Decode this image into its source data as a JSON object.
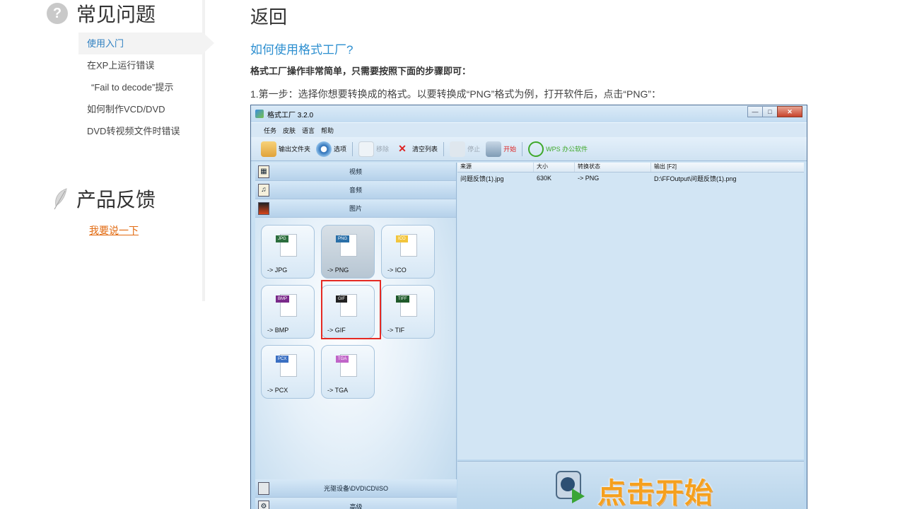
{
  "sidebar": {
    "faq_icon": "question-circle-icon",
    "faq_title": "常见问题",
    "items": [
      {
        "label": "使用入门"
      },
      {
        "label": "在XP上运行错误"
      },
      {
        "label": "“Fail to decode”提示"
      },
      {
        "label": "如何制作VCD/DVD"
      },
      {
        "label": "DVD转视频文件时错误"
      }
    ],
    "feedback_icon": "leaf-icon",
    "feedback_title": "产品反馈",
    "feedback_link": "我要说一下"
  },
  "main": {
    "back_title": "返回",
    "question_title": "如何使用格式工厂?",
    "intro": "格式工厂操作非常简单，只需要按照下面的步骤即可：",
    "step1": "1.第一步：选择你想要转换成的格式。以要转换成“PNG”格式为例，打开软件后，点击“PNG”："
  },
  "app": {
    "title": "格式工厂 3.2.0",
    "window_buttons": [
      "—",
      "□",
      "✕"
    ],
    "menu": [
      "任务",
      "皮肤",
      "语言",
      "帮助"
    ],
    "toolbar": {
      "output_folder": "输出文件夹",
      "options": "选项",
      "remove": "移除",
      "clear_list": "清空列表",
      "stop": "停止",
      "start": "开始",
      "wps": "WPS 办公软件"
    },
    "categories": [
      "视频",
      "音频",
      "图片"
    ],
    "bottom_categories": [
      "光驱设备\\DVD\\CD\\ISO",
      "高级"
    ],
    "tiles": [
      {
        "tag": "JPG",
        "label": "-> JPG",
        "color": "#2c6e3d"
      },
      {
        "tag": "PNG",
        "label": "-> PNG",
        "color": "#2a6fa8"
      },
      {
        "tag": "ICO",
        "label": "-> ICO",
        "color": "#f2c53d"
      },
      {
        "tag": "BMP",
        "label": "-> BMP",
        "color": "#7a2a8a"
      },
      {
        "tag": "GIF",
        "label": "-> GIF",
        "color": "#222222"
      },
      {
        "tag": "TIFF",
        "label": "-> TIF",
        "color": "#1f5a2a"
      },
      {
        "tag": "PCX",
        "label": "-> PCX",
        "color": "#3a6fc2"
      },
      {
        "tag": "TGA",
        "label": "-> TGA",
        "color": "#c065c8"
      }
    ],
    "table_headers": [
      "来源",
      "大小",
      "转换状态",
      "输出 [F2]"
    ],
    "table_rows": [
      {
        "source": "问题反馈(1).jpg",
        "size": "630K",
        "status": "-> PNG",
        "output": "D:\\FFOutput\\问题反馈(1).png"
      }
    ],
    "start_banner": "点击开始"
  },
  "colors": {
    "link": "#2d8fd0",
    "feedback_link": "#e26a10",
    "highlight": "#e52a23",
    "start_text": "#f5a01e"
  }
}
